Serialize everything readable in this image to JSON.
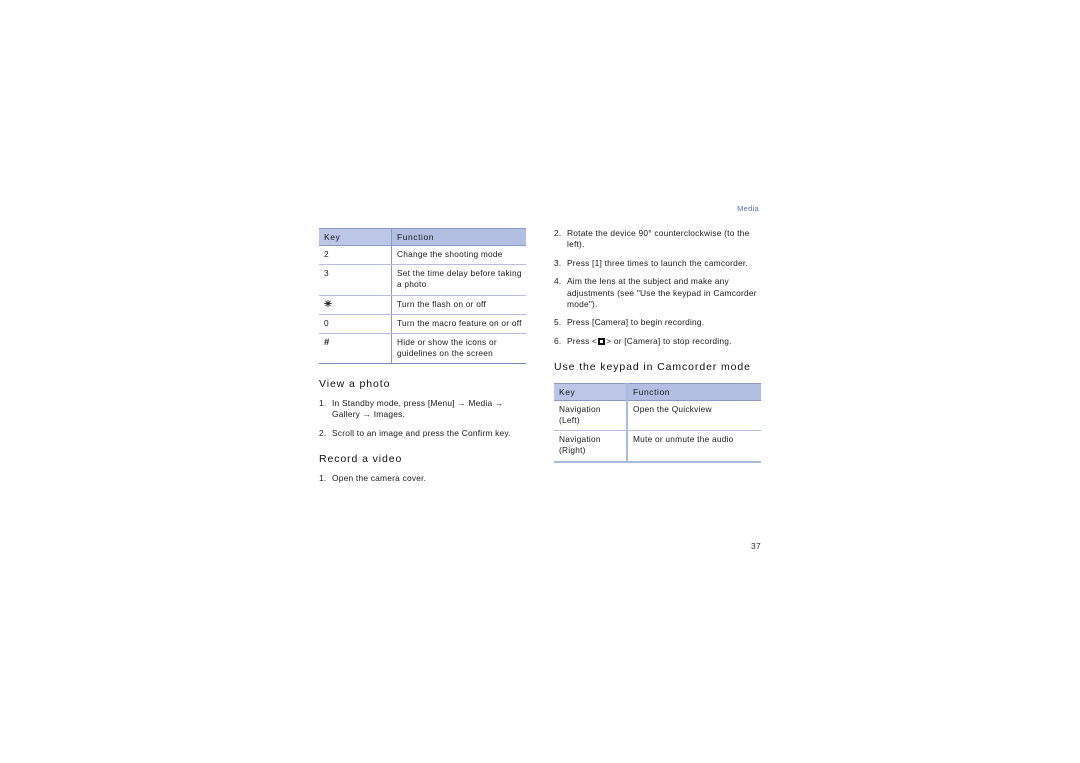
{
  "document": {
    "running_header": "Media",
    "page_number": "37",
    "accent_color": "#5b72bd",
    "table_header_bg": "#b9c4e4",
    "table_rule_color": "#8a9ac4"
  },
  "left_column": {
    "camera_key_table": {
      "headers": [
        "Key",
        "Function"
      ],
      "rows": [
        {
          "key": "2",
          "key_glyph": "",
          "function": "Change the shooting mode"
        },
        {
          "key": "3",
          "key_glyph": "",
          "function": "Set the time delay before taking a photo"
        },
        {
          "key": "",
          "key_glyph": "✳",
          "function": "Turn the flash on or off"
        },
        {
          "key": "0",
          "key_glyph": "",
          "function": "Turn the macro feature on or off"
        },
        {
          "key": "",
          "key_glyph": "#",
          "function": "Hide or show the icons or guidelines on the screen"
        }
      ]
    },
    "view_a_photo": {
      "heading": "View a photo",
      "steps": [
        {
          "marker": "1.",
          "text": "In Standby mode, press [Menu] → Media → Gallery → Images."
        },
        {
          "marker": "2.",
          "text": "Scroll to an image and press the Confirm key."
        }
      ]
    },
    "record_a_video": {
      "heading": "Record a video",
      "steps": [
        {
          "marker": "1.",
          "text": "Open the camera cover."
        }
      ]
    }
  },
  "right_column": {
    "record_steps_continued": [
      {
        "marker": "2.",
        "text": "Rotate the device 90° counterclockwise (to the left)."
      },
      {
        "marker": "3.",
        "text": "Press [1] three times to launch the camcorder."
      },
      {
        "marker": "4.",
        "text": "Aim the lens at the subject and make any adjustments (see \"Use the keypad in Camcorder mode\")."
      },
      {
        "marker": "5.",
        "text": "Press [Camera] to begin recording."
      },
      {
        "marker": "6.",
        "text_before_icon": "Press <",
        "icon": "softkey-square-icon",
        "text_after_icon": "> or [Camera] to stop recording."
      }
    ],
    "camcorder_section": {
      "heading": "Use the keypad in Camcorder mode",
      "key_table": {
        "headers": [
          "Key",
          "Function"
        ],
        "rows": [
          {
            "key": "Navigation (Left)",
            "function": "Open the Quickview"
          },
          {
            "key": "Navigation (Right)",
            "function": "Mute or unmute the audio"
          }
        ]
      }
    }
  }
}
